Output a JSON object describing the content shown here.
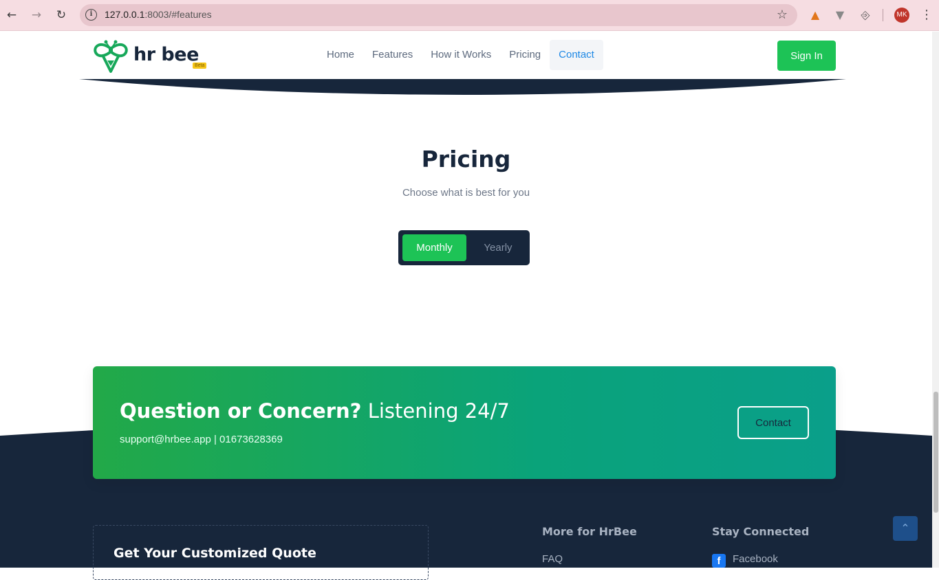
{
  "browser": {
    "url_host": "127.0.0.1",
    "url_rest": ":8003/#features",
    "avatar_initials": "MK"
  },
  "header": {
    "logo_text": "hr bee",
    "beta_label": "Beta",
    "nav": [
      "Home",
      "Features",
      "How it Works",
      "Pricing",
      "Contact"
    ],
    "active_nav": "Contact",
    "signin_label": "Sign In"
  },
  "pricing": {
    "title": "Pricing",
    "subtitle": "Choose what is best for you",
    "toggle": {
      "monthly": "Monthly",
      "yearly": "Yearly",
      "selected": "Monthly"
    }
  },
  "cta": {
    "title_bold": "Question or Concern?",
    "title_light": "Listening 24/7",
    "contact_info": "support@hrbee.app | 01673628369",
    "button_label": "Contact"
  },
  "footer": {
    "quote_title": "Get Your Customized Quote",
    "more_title": "More for HrBee",
    "more_links": [
      "FAQ"
    ],
    "social_title": "Stay Connected",
    "social_links": [
      "Facebook"
    ]
  },
  "colors": {
    "brand_green": "#1dc356",
    "navy": "#17263b",
    "link_blue": "#1e88e5"
  }
}
